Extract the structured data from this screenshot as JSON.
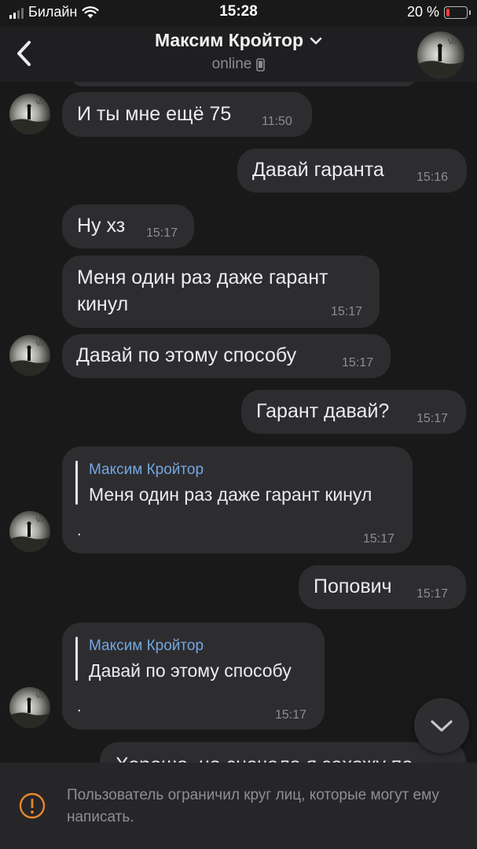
{
  "status_bar": {
    "carrier": "Билайн",
    "time": "15:28",
    "battery": "20 %",
    "battery_level": 0.2
  },
  "header": {
    "contact_name": "Максим Кройтор",
    "status": "online"
  },
  "messages": [
    {
      "from": "contact",
      "text": "И ты мне ещё 75",
      "time": "11:50"
    },
    {
      "from": "me",
      "text": "Давай гаранта",
      "time": "15:16"
    },
    {
      "from": "contact",
      "text": "Ну хз",
      "time": "15:17"
    },
    {
      "from": "contact",
      "text_line1": "Меня один раз даже гарант",
      "text_line2": "кинул",
      "time": "15:17"
    },
    {
      "from": "contact",
      "text": "Давай по этому способу",
      "time": "15:17"
    },
    {
      "from": "me",
      "text": "Гарант давай?",
      "time": "15:17"
    },
    {
      "from": "contact",
      "reply_name": "Максим Кройтор",
      "reply_text": "Меня один раз даже гарант кинул",
      "text": ".",
      "time": "15:17"
    },
    {
      "from": "me",
      "text": "Попович",
      "time": "15:17"
    },
    {
      "from": "contact",
      "reply_name": "Максим Кройтор",
      "reply_text": "Давай по этому способу",
      "text": ".",
      "time": "15:17"
    },
    {
      "from": "me",
      "text": "Хорошо, но сначала я захожу по",
      "time": ""
    }
  ],
  "footer": {
    "notice": "Пользователь ограничил круг лиц, которые могут ему написать."
  },
  "icons": {
    "back": "chevron-left-icon",
    "dropdown": "chevron-down-icon",
    "device": "phone-icon",
    "scroll": "chevron-down-icon",
    "warning": "warning-icon"
  },
  "colors": {
    "background": "#19191a",
    "bubble": "#2d2d30",
    "reply_name": "#74a7e0",
    "battery_low": "#ff3b30"
  }
}
